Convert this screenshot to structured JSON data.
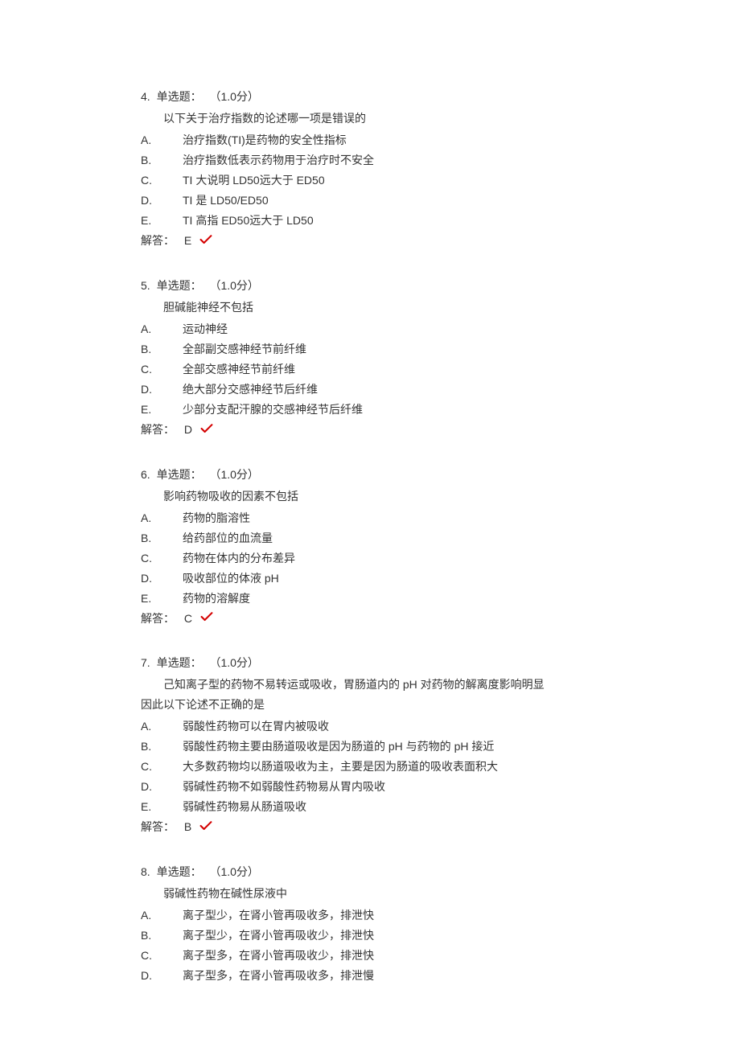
{
  "questions": [
    {
      "number": "4.",
      "type": "单选题：",
      "points": "（1.0分）",
      "stem": "以下关于治疗指数的论述哪一项是错误的",
      "options": [
        {
          "letter": "A.",
          "text": "治疗指数(TI)是药物的安全性指标"
        },
        {
          "letter": "B.",
          "text": "治疗指数低表示药物用于治疗时不安全"
        },
        {
          "letter": "C.",
          "text": "TI 大说明 LD50远大于 ED50"
        },
        {
          "letter": "D.",
          "text": "TI 是 LD50/ED50"
        },
        {
          "letter": "E.",
          "text": "TI 高指 ED50远大于 LD50"
        }
      ],
      "answer_label": "解答：",
      "answer": "E"
    },
    {
      "number": "5.",
      "type": "单选题：",
      "points": "（1.0分）",
      "stem": "胆碱能神经不包括",
      "options": [
        {
          "letter": "A.",
          "text": "运动神经"
        },
        {
          "letter": "B.",
          "text": "全部副交感神经节前纤维"
        },
        {
          "letter": "C.",
          "text": "全部交感神经节前纤维"
        },
        {
          "letter": "D.",
          "text": "绝大部分交感神经节后纤维"
        },
        {
          "letter": "E.",
          "text": "少部分支配汗腺的交感神经节后纤维"
        }
      ],
      "answer_label": "解答：",
      "answer": "D"
    },
    {
      "number": "6.",
      "type": "单选题：",
      "points": "（1.0分）",
      "stem": "影响药物吸收的因素不包括",
      "options": [
        {
          "letter": "A.",
          "text": "药物的脂溶性"
        },
        {
          "letter": "B.",
          "text": "给药部位的血流量"
        },
        {
          "letter": "C.",
          "text": "药物在体内的分布差异"
        },
        {
          "letter": "D.",
          "text": "吸收部位的体液 pH"
        },
        {
          "letter": "E.",
          "text": "药物的溶解度"
        }
      ],
      "answer_label": "解答：",
      "answer": "C"
    },
    {
      "number": "7.",
      "type": "单选题：",
      "points": "（1.0分）",
      "stem": "己知离子型的药物不易转运或吸收，胃肠道内的 pH 对药物的解离度影响明显",
      "stem2": "因此以下论述不正确的是",
      "options": [
        {
          "letter": "A.",
          "text": "弱酸性药物可以在胃内被吸收"
        },
        {
          "letter": "B.",
          "text": "弱酸性药物主要由肠道吸收是因为肠道的 pH 与药物的 pH 接近"
        },
        {
          "letter": "C.",
          "text": "大多数药物均以肠道吸收为主，主要是因为肠道的吸收表面积大"
        },
        {
          "letter": "D.",
          "text": "弱碱性药物不如弱酸性药物易从胃内吸收"
        },
        {
          "letter": "E.",
          "text": "弱碱性药物易从肠道吸收"
        }
      ],
      "answer_label": "解答：",
      "answer": "B"
    },
    {
      "number": "8.",
      "type": "单选题：",
      "points": "（1.0分）",
      "stem": "弱碱性药物在碱性尿液中",
      "options": [
        {
          "letter": "A.",
          "text": "离子型少，在肾小管再吸收多，排泄快"
        },
        {
          "letter": "B.",
          "text": "离子型少，在肾小管再吸收少，排泄快"
        },
        {
          "letter": "C.",
          "text": "离子型多，在肾小管再吸收少，排泄快"
        },
        {
          "letter": "D.",
          "text": "离子型多，在肾小管再吸收多，排泄慢"
        }
      ],
      "answer_label": "",
      "answer": ""
    }
  ]
}
